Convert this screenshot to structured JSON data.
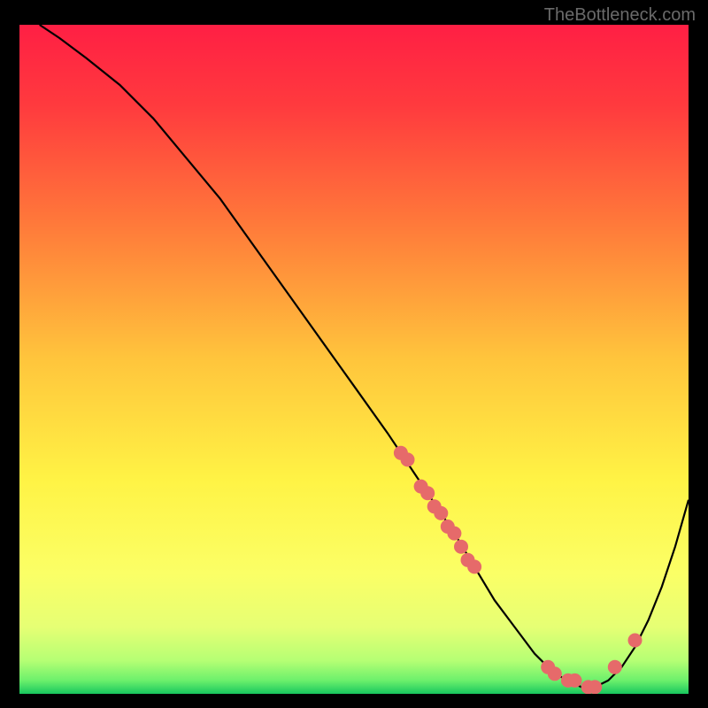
{
  "watermark": "TheBottleneck.com",
  "chart_data": {
    "type": "line",
    "title": "",
    "xlabel": "",
    "ylabel": "",
    "xlim": [
      0,
      100
    ],
    "ylim": [
      0,
      100
    ],
    "grid": false,
    "background": "red-yellow-green-vertical-gradient",
    "series": [
      {
        "name": "bottleneck-curve",
        "color": "#000000",
        "x": [
          3,
          6,
          10,
          15,
          20,
          25,
          30,
          35,
          40,
          45,
          50,
          55,
          57,
          59,
          61,
          63,
          65,
          68,
          71,
          74,
          77,
          80,
          82,
          84,
          86,
          88,
          90,
          92,
          94,
          96,
          98,
          100
        ],
        "y": [
          100,
          98,
          95,
          91,
          86,
          80,
          74,
          67,
          60,
          53,
          46,
          39,
          36,
          33,
          30,
          27,
          24,
          19,
          14,
          10,
          6,
          3,
          2,
          1,
          1,
          2,
          4,
          7,
          11,
          16,
          22,
          29
        ]
      }
    ],
    "scatter_points": {
      "name": "highlighted-points",
      "color": "#e66a6a",
      "radius": 8,
      "x": [
        57,
        58,
        60,
        61,
        62,
        63,
        64,
        65,
        66,
        67,
        68,
        79,
        80,
        82,
        83,
        85,
        86,
        89,
        92
      ],
      "y": [
        36,
        35,
        31,
        30,
        28,
        27,
        25,
        24,
        22,
        20,
        19,
        4,
        3,
        2,
        2,
        1,
        1,
        4,
        8
      ]
    }
  }
}
